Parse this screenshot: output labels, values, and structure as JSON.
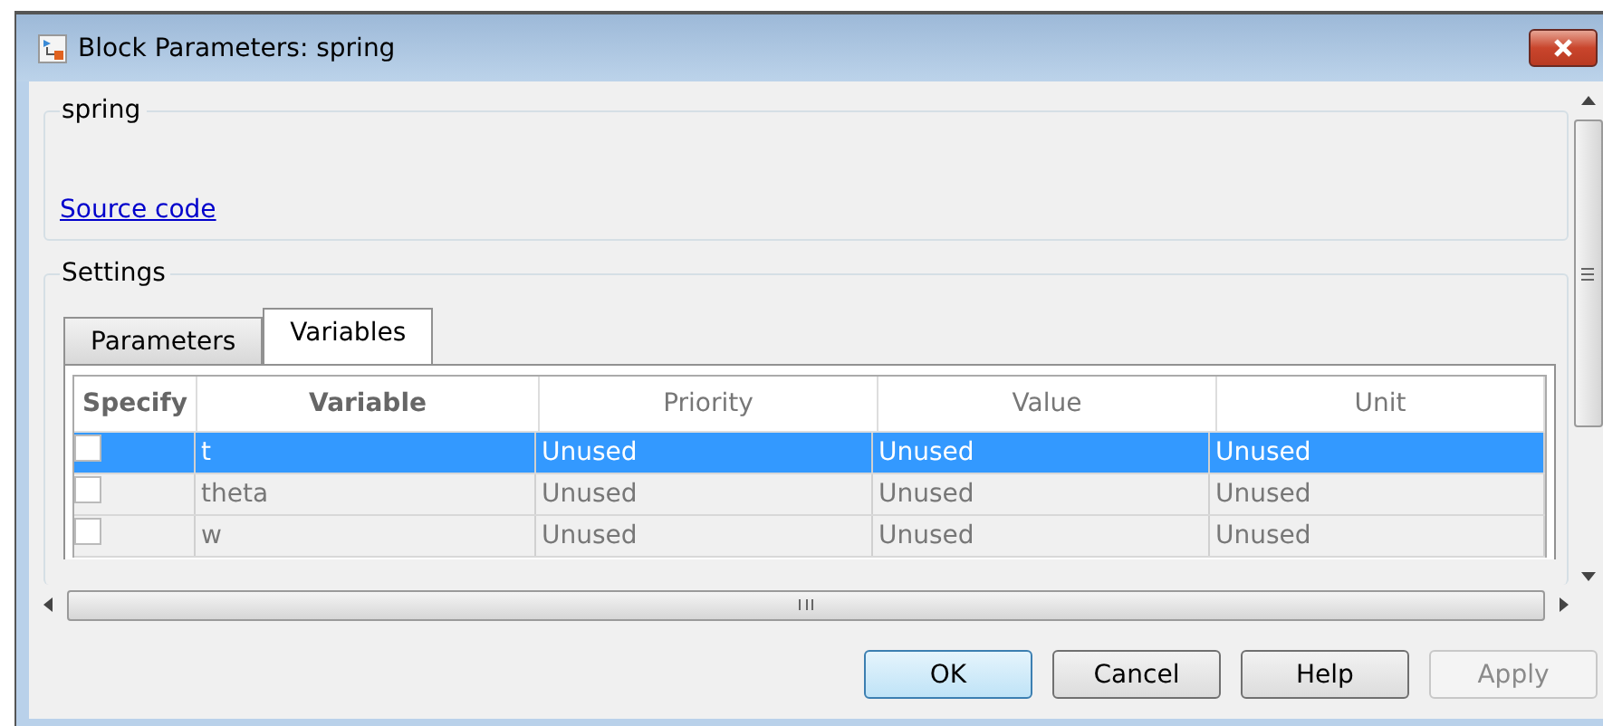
{
  "window": {
    "title": "Block Parameters: spring"
  },
  "block_group": {
    "title": "spring",
    "link": "Source code"
  },
  "settings": {
    "title": "Settings",
    "tabs": [
      {
        "label": "Parameters",
        "selected": false
      },
      {
        "label": "Variables",
        "selected": true
      }
    ],
    "table": {
      "columns": [
        "Specify",
        "Variable",
        "Priority",
        "Value",
        "Unit"
      ],
      "rows": [
        {
          "selected": true,
          "checked": false,
          "cells": [
            "t",
            "Unused",
            "Unused",
            "Unused"
          ]
        },
        {
          "selected": false,
          "checked": false,
          "cells": [
            "theta",
            "Unused",
            "Unused",
            "Unused"
          ]
        },
        {
          "selected": false,
          "checked": false,
          "cells": [
            "w",
            "Unused",
            "Unused",
            "Unused"
          ]
        }
      ]
    }
  },
  "buttons": [
    {
      "label": "OK",
      "default": true,
      "disabled": false
    },
    {
      "label": "Cancel",
      "default": false,
      "disabled": false
    },
    {
      "label": "Help",
      "default": false,
      "disabled": false
    },
    {
      "label": "Apply",
      "default": false,
      "disabled": true
    }
  ]
}
